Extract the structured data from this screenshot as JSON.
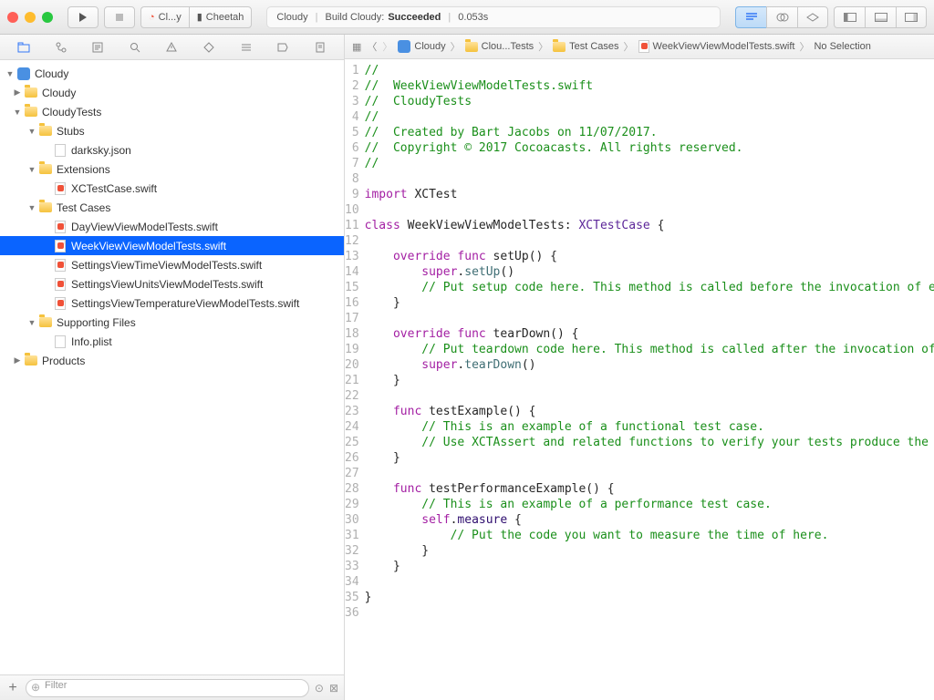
{
  "toolbar": {
    "scheme": "Cl...y",
    "destination": "Cheetah",
    "status_project": "Cloudy",
    "status_action": "Build Cloudy:",
    "status_result": "Succeeded",
    "status_time": "0.053s"
  },
  "breadcrumb": {
    "items": [
      "Cloudy",
      "Clou...Tests",
      "Test Cases",
      "WeekViewViewModelTests.swift",
      "No Selection"
    ]
  },
  "tree": {
    "root": "Cloudy",
    "nodes": [
      {
        "label": "Cloudy",
        "type": "project",
        "indent": 0,
        "open": true
      },
      {
        "label": "Cloudy",
        "type": "folder",
        "indent": 1,
        "open": false,
        "closed": true
      },
      {
        "label": "CloudyTests",
        "type": "folder",
        "indent": 1,
        "open": true
      },
      {
        "label": "Stubs",
        "type": "folder",
        "indent": 2,
        "open": true
      },
      {
        "label": "darksky.json",
        "type": "json",
        "indent": 3
      },
      {
        "label": "Extensions",
        "type": "folder",
        "indent": 2,
        "open": true
      },
      {
        "label": "XCTestCase.swift",
        "type": "swift",
        "indent": 3
      },
      {
        "label": "Test Cases",
        "type": "folder",
        "indent": 2,
        "open": true
      },
      {
        "label": "DayViewViewModelTests.swift",
        "type": "swift",
        "indent": 3
      },
      {
        "label": "WeekViewViewModelTests.swift",
        "type": "swift",
        "indent": 3,
        "selected": true
      },
      {
        "label": "SettingsViewTimeViewModelTests.swift",
        "type": "swift",
        "indent": 3
      },
      {
        "label": "SettingsViewUnitsViewModelTests.swift",
        "type": "swift",
        "indent": 3
      },
      {
        "label": "SettingsViewTemperatureViewModelTests.swift",
        "type": "swift",
        "indent": 3
      },
      {
        "label": "Supporting Files",
        "type": "folder",
        "indent": 2,
        "open": true
      },
      {
        "label": "Info.plist",
        "type": "plist",
        "indent": 3
      },
      {
        "label": "Products",
        "type": "folder",
        "indent": 1,
        "open": false,
        "closed": true
      }
    ]
  },
  "filter": {
    "placeholder": "Filter"
  },
  "footer": {
    "add": "+"
  },
  "code": {
    "lines": [
      {
        "n": 1,
        "tokens": [
          {
            "t": "//",
            "c": "comment"
          }
        ]
      },
      {
        "n": 2,
        "tokens": [
          {
            "t": "//  WeekViewViewModelTests.swift",
            "c": "comment"
          }
        ]
      },
      {
        "n": 3,
        "tokens": [
          {
            "t": "//  CloudyTests",
            "c": "comment"
          }
        ]
      },
      {
        "n": 4,
        "tokens": [
          {
            "t": "//",
            "c": "comment"
          }
        ]
      },
      {
        "n": 5,
        "tokens": [
          {
            "t": "//  Created by Bart Jacobs on 11/07/2017.",
            "c": "comment"
          }
        ]
      },
      {
        "n": 6,
        "tokens": [
          {
            "t": "//  Copyright © 2017 Cocoacasts. All rights reserved.",
            "c": "comment"
          }
        ]
      },
      {
        "n": 7,
        "tokens": [
          {
            "t": "//",
            "c": "comment"
          }
        ]
      },
      {
        "n": 8,
        "tokens": []
      },
      {
        "n": 9,
        "tokens": [
          {
            "t": "import",
            "c": "kw"
          },
          {
            "t": " XCTest"
          }
        ]
      },
      {
        "n": 10,
        "tokens": []
      },
      {
        "n": 11,
        "diamond": true,
        "tokens": [
          {
            "t": "class",
            "c": "kw"
          },
          {
            "t": " WeekViewViewModelTests: "
          },
          {
            "t": "XCTestCase",
            "c": "typesys"
          },
          {
            "t": " {"
          }
        ]
      },
      {
        "n": 12,
        "tokens": []
      },
      {
        "n": 13,
        "tokens": [
          {
            "t": "    "
          },
          {
            "t": "override",
            "c": "kw"
          },
          {
            "t": " "
          },
          {
            "t": "func",
            "c": "kw"
          },
          {
            "t": " setUp() {"
          }
        ]
      },
      {
        "n": 14,
        "tokens": [
          {
            "t": "        "
          },
          {
            "t": "super",
            "c": "kw"
          },
          {
            "t": "."
          },
          {
            "t": "setUp",
            "c": "callsys"
          },
          {
            "t": "()"
          }
        ]
      },
      {
        "n": 15,
        "tokens": [
          {
            "t": "        "
          },
          {
            "t": "// Put setup code here. This method is called before the invocation of each",
            "c": "comment"
          }
        ]
      },
      {
        "n": 16,
        "tokens": [
          {
            "t": "    }"
          }
        ]
      },
      {
        "n": 17,
        "tokens": []
      },
      {
        "n": 18,
        "tokens": [
          {
            "t": "    "
          },
          {
            "t": "override",
            "c": "kw"
          },
          {
            "t": " "
          },
          {
            "t": "func",
            "c": "kw"
          },
          {
            "t": " tearDown() {"
          }
        ]
      },
      {
        "n": 19,
        "tokens": [
          {
            "t": "        "
          },
          {
            "t": "// Put teardown code here. This method is called after the invocation of eac",
            "c": "comment"
          }
        ]
      },
      {
        "n": 20,
        "tokens": [
          {
            "t": "        "
          },
          {
            "t": "super",
            "c": "kw"
          },
          {
            "t": "."
          },
          {
            "t": "tearDown",
            "c": "callsys"
          },
          {
            "t": "()"
          }
        ]
      },
      {
        "n": 21,
        "tokens": [
          {
            "t": "    }"
          }
        ]
      },
      {
        "n": 22,
        "tokens": []
      },
      {
        "n": 23,
        "diamond": true,
        "tokens": [
          {
            "t": "    "
          },
          {
            "t": "func",
            "c": "kw"
          },
          {
            "t": " testExample() {"
          }
        ]
      },
      {
        "n": 24,
        "tokens": [
          {
            "t": "        "
          },
          {
            "t": "// This is an example of a functional test case.",
            "c": "comment"
          }
        ]
      },
      {
        "n": 25,
        "tokens": [
          {
            "t": "        "
          },
          {
            "t": "// Use XCTAssert and related functions to verify your tests produce the cor",
            "c": "comment"
          }
        ]
      },
      {
        "n": 26,
        "tokens": [
          {
            "t": "    }"
          }
        ]
      },
      {
        "n": 27,
        "tokens": []
      },
      {
        "n": 28,
        "diamond": true,
        "tokens": [
          {
            "t": "    "
          },
          {
            "t": "func",
            "c": "kw"
          },
          {
            "t": " testPerformanceExample() {"
          }
        ]
      },
      {
        "n": 29,
        "tokens": [
          {
            "t": "        "
          },
          {
            "t": "// This is an example of a performance test case.",
            "c": "comment"
          }
        ]
      },
      {
        "n": 30,
        "tokens": [
          {
            "t": "        "
          },
          {
            "t": "self",
            "c": "kw"
          },
          {
            "t": "."
          },
          {
            "t": "measure",
            "c": "call"
          },
          {
            "t": " {"
          }
        ]
      },
      {
        "n": 31,
        "tokens": [
          {
            "t": "            "
          },
          {
            "t": "// Put the code you want to measure the time of here.",
            "c": "comment"
          }
        ]
      },
      {
        "n": 32,
        "tokens": [
          {
            "t": "        }"
          }
        ]
      },
      {
        "n": 33,
        "tokens": [
          {
            "t": "    }"
          }
        ]
      },
      {
        "n": 34,
        "tokens": []
      },
      {
        "n": 35,
        "tokens": [
          {
            "t": "}"
          }
        ]
      },
      {
        "n": 36,
        "tokens": []
      }
    ]
  }
}
